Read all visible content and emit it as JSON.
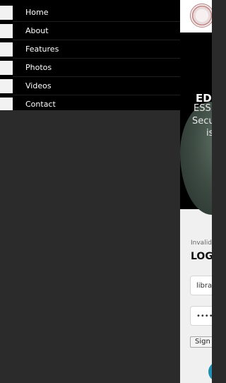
{
  "nav": {
    "items": [
      {
        "label": "Home"
      },
      {
        "label": "About"
      },
      {
        "label": "Features"
      },
      {
        "label": "Photos"
      },
      {
        "label": "Videos"
      },
      {
        "label": "Contact"
      }
    ]
  },
  "hero": {
    "title": "ED",
    "lines": [
      "ESS",
      "Secu",
      "is"
    ]
  },
  "login": {
    "invalid_text": "Invalid",
    "title": "LOG",
    "username_value": "librar",
    "password_value": "••••••••",
    "signin_label": "Sign"
  },
  "colors": {
    "nav_bg": "#000000",
    "panel_bg": "#2b2b2b",
    "accent_fab": "#1f8fb3"
  }
}
